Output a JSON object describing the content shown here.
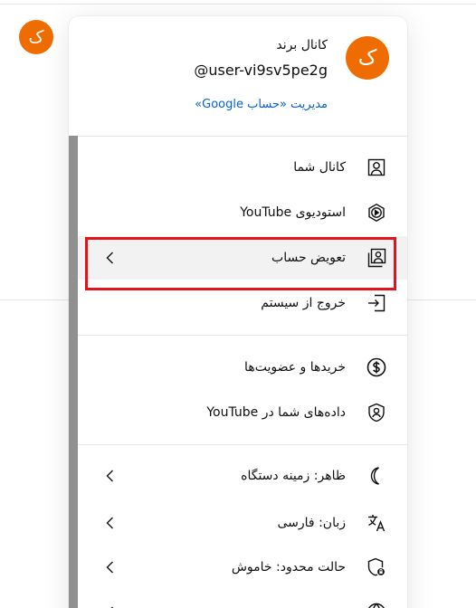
{
  "background": {
    "avatar_letter": "ک"
  },
  "account": {
    "avatar_letter": "ک",
    "avatar_color": "#ef6c00",
    "channel_name": "کانال برند",
    "handle": "@user-vi9sv5pe2g",
    "manage_link": "مدیریت «حساب Google»"
  },
  "menu": {
    "section1": [
      {
        "label": "کانال شما",
        "icon": "person-box-icon",
        "chevron": false
      },
      {
        "label": "استودیوی YouTube",
        "icon": "studio-play-icon",
        "chevron": false
      },
      {
        "label": "تعویض حساب",
        "icon": "switch-account-icon",
        "chevron": true,
        "active": true
      },
      {
        "label": "خروج از سیستم",
        "icon": "sign-out-icon",
        "chevron": false
      }
    ],
    "section2": [
      {
        "label": "خریدها و عضویت‌ها",
        "icon": "dollar-circle-icon",
        "chevron": false
      },
      {
        "label": "داده‌های شما در YouTube",
        "icon": "shield-person-icon",
        "chevron": false
      }
    ],
    "section3": [
      {
        "label": "ظاهر: زمینه دستگاه",
        "icon": "moon-icon",
        "chevron": true
      },
      {
        "label": "زبان: فارسی",
        "icon": "translate-icon",
        "chevron": true
      },
      {
        "label": "حالت محدود: خاموش",
        "icon": "restricted-shield-icon",
        "chevron": true
      },
      {
        "label": "",
        "icon": "globe-icon",
        "chevron": true
      }
    ]
  },
  "highlight_color": "#e3131b"
}
